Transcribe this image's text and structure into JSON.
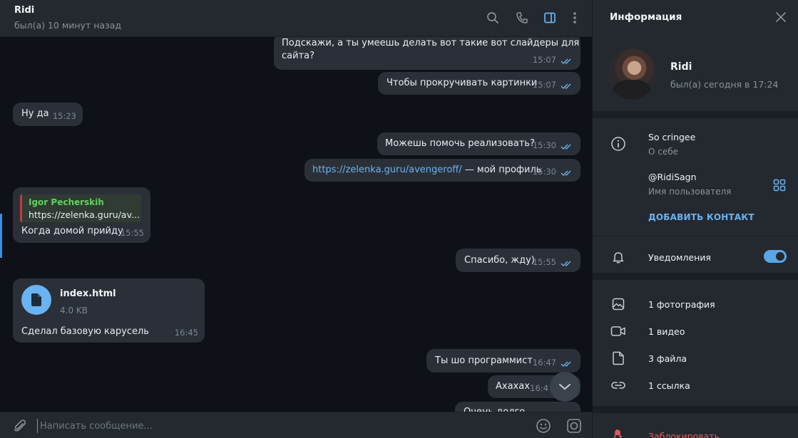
{
  "chat": {
    "title": "Ridi",
    "status": "был(а) 10 минут назад",
    "header_icons": [
      "search-icon",
      "phone-icon",
      "sidebar-toggle-icon",
      "more-vertical-icon"
    ]
  },
  "messages": [
    {
      "dir": "out",
      "text_line1": "Подскажи, а ты умеешь делать вот такие вот слайдеры для",
      "text_line2": "сайта?",
      "time": "15:07"
    },
    {
      "dir": "out",
      "text": "Чтобы прокручивать картинки",
      "time": "15:07"
    },
    {
      "dir": "in",
      "text": "Ну да",
      "time": "15:23"
    },
    {
      "dir": "out",
      "text": "Можешь помочь реализовать?",
      "time": "15:30"
    },
    {
      "dir": "out",
      "link": "https://zelenka.guru/avengeroff/",
      "text": " — мой профиль",
      "time": "15:30"
    },
    {
      "dir": "in",
      "quote_name": "Igor Pecherskih",
      "quote_text": "https://zelenka.guru/av...",
      "text": "Когда домой прийду",
      "time": "15:55"
    },
    {
      "dir": "out",
      "text": "Спасибо, жду)",
      "time": "15:55"
    },
    {
      "dir": "in",
      "file_name": "index.html",
      "file_size": "4.0 KB",
      "text": "Сделал базовую карусель",
      "time": "16:45"
    },
    {
      "dir": "out",
      "text": "Ты шо программист",
      "time": "16:47"
    },
    {
      "dir": "out",
      "text": "Ахахах",
      "time": "16:4"
    },
    {
      "dir": "out",
      "text": "Очень долго",
      "time": ""
    }
  ],
  "composer": {
    "placeholder": "Написать сообщение..."
  },
  "info": {
    "title": "Информация",
    "name": "Ridi",
    "status": "был(а) сегодня в 17:24",
    "bio": "So cringee",
    "bio_label": "О себе",
    "username": "@RidiSagn",
    "username_label": "Имя пользователя",
    "add_contact": "ДОБАВИТЬ КОНТАКТ",
    "notifications": "Уведомления",
    "notifications_on": true,
    "media": [
      {
        "label": "1 фотография",
        "icon": "photo-icon"
      },
      {
        "label": "1 видео",
        "icon": "video-icon"
      },
      {
        "label": "3 файла",
        "icon": "file-icon"
      },
      {
        "label": "1 ссылка",
        "icon": "link-icon"
      }
    ],
    "block": "Заблокировать"
  },
  "colors": {
    "accent": "#6ab3f3",
    "bubble": "#2b3038",
    "panel": "#242930",
    "background": "#0e1117",
    "danger": "#e05c5c"
  }
}
